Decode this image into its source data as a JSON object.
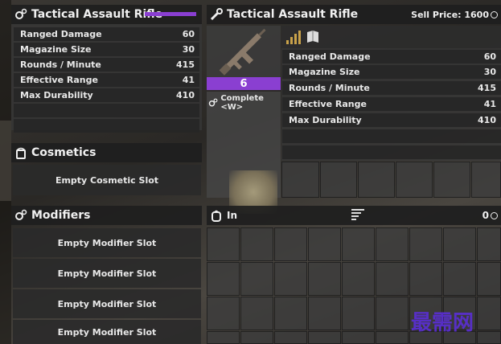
{
  "left": {
    "title": "Tactical Assault Rifle",
    "stats": [
      {
        "label": "Ranged Damage",
        "value": "60"
      },
      {
        "label": "Magazine Size",
        "value": "30"
      },
      {
        "label": "Rounds / Minute",
        "value": "415"
      },
      {
        "label": "Effective Range",
        "value": "41"
      },
      {
        "label": "Max Durability",
        "value": "410"
      }
    ],
    "cosmetics": {
      "title": "Cosmetics",
      "slot": "Empty Cosmetic Slot"
    },
    "modifiers": {
      "title": "Modifiers",
      "slots": [
        "Empty Modifier Slot",
        "Empty Modifier Slot",
        "Empty Modifier Slot",
        "Empty Modifier Slot"
      ]
    }
  },
  "right": {
    "title": "Tactical Assault Rifle",
    "sell_label": "Sell Price: 1600",
    "item_quality": "6",
    "item_quality_color": "#8a3fd1",
    "complete_label": "Complete <W>",
    "stats": [
      {
        "label": "Ranged Damage",
        "value": "60"
      },
      {
        "label": "Magazine Size",
        "value": "30"
      },
      {
        "label": "Rounds / Minute",
        "value": "415"
      },
      {
        "label": "Effective Range",
        "value": "41"
      },
      {
        "label": "Max Durability",
        "value": "410"
      }
    ],
    "inventory_label": "In",
    "inventory_count": "0"
  },
  "watermark": "最需网"
}
